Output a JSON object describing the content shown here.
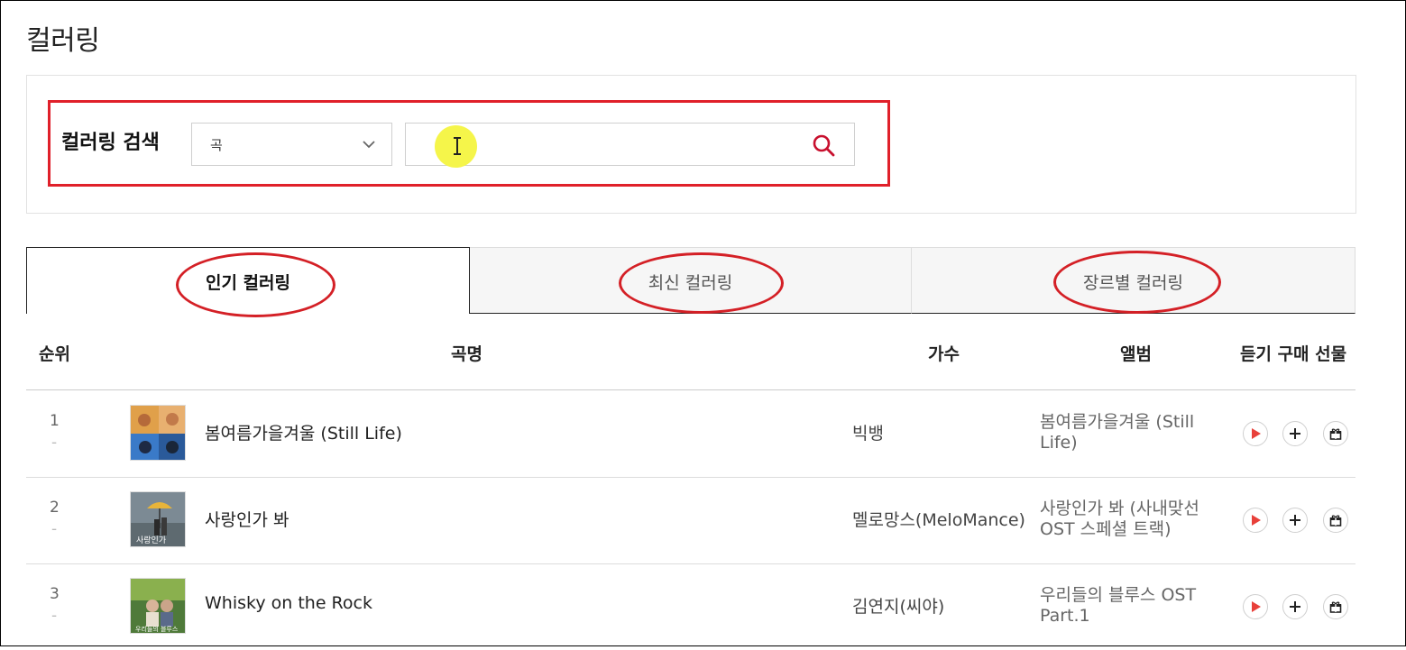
{
  "page": {
    "title": "컬러링"
  },
  "search": {
    "label": "컬러링 검색",
    "type_selected": "곡",
    "query": "",
    "placeholder": ""
  },
  "tabs": [
    {
      "label": "인기 컬러링",
      "active": true
    },
    {
      "label": "최신 컬러링",
      "active": false
    },
    {
      "label": "장르별 컬러링",
      "active": false
    }
  ],
  "table": {
    "headers": {
      "rank": "순위",
      "song": "곡명",
      "artist": "가수",
      "album": "앨범",
      "actions": "듣기 구매 선물"
    },
    "rows": [
      {
        "rank": "1",
        "change": "-",
        "song": "봄여름가을겨울 (Still Life)",
        "artist": "빅뱅",
        "album": "봄여름가을겨울 (Still Life)"
      },
      {
        "rank": "2",
        "change": "-",
        "song": "사랑인가 봐",
        "artist": "멜로망스(MeloMance)",
        "album": "사랑인가 봐 (사내맞선 OST 스페셜 트랙)"
      },
      {
        "rank": "3",
        "change": "-",
        "song": "Whisky on the Rock",
        "artist": "김연지(씨야)",
        "album": "우리들의 블루스 OST Part.1"
      }
    ]
  },
  "colors": {
    "accent": "#e0202a",
    "icon_red": "#e8403a",
    "search_icon": "#c8102e",
    "cursor_highlight": "#f5f54a"
  },
  "icons": [
    "chevron-down-icon",
    "search-icon",
    "text-cursor-icon",
    "play-icon",
    "plus-icon",
    "gift-icon"
  ]
}
